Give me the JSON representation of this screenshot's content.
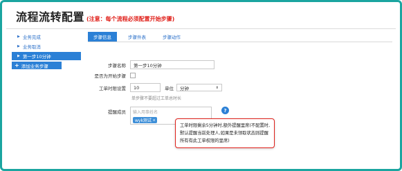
{
  "header": {
    "title": "流程流转配置",
    "notice": "(注意：每个流程必须配置开始步骤)"
  },
  "sidebar": {
    "items": [
      {
        "label": "业务完成",
        "active": false
      },
      {
        "label": "业务取消",
        "active": false
      },
      {
        "label": "第一步10分钟",
        "active": true
      }
    ],
    "add_label": "添加业务步骤"
  },
  "tabs": [
    {
      "label": "步骤信息",
      "active": true
    },
    {
      "label": "步骤件表",
      "active": false
    },
    {
      "label": "步骤动作",
      "active": false
    }
  ],
  "form": {
    "step_name": {
      "label": "步骤名称",
      "value": "第一步10分钟"
    },
    "is_start": {
      "label": "是否为开始步骤",
      "checked": false
    },
    "timeout": {
      "label": "工单时限设置",
      "value": "10",
      "unit_label": "单位",
      "unit_value": "分钟",
      "hint": "单步骤不要超过工单总时长"
    },
    "reminder": {
      "label": "提醒成员",
      "placeholder": "输入用事姓名",
      "tag": "wyk测试"
    }
  },
  "tooltip": {
    "lines": [
      "工单时限剩余5分钟时,额外提醒里席(不配置时,",
      "默认提醒当前处理人,如果是未领取状态则提醒",
      "所有有此工单权限的里席)"
    ]
  },
  "colors": {
    "accent": "#2b80d6",
    "frame": "#1aa5a0",
    "warning": "#e0201a"
  }
}
